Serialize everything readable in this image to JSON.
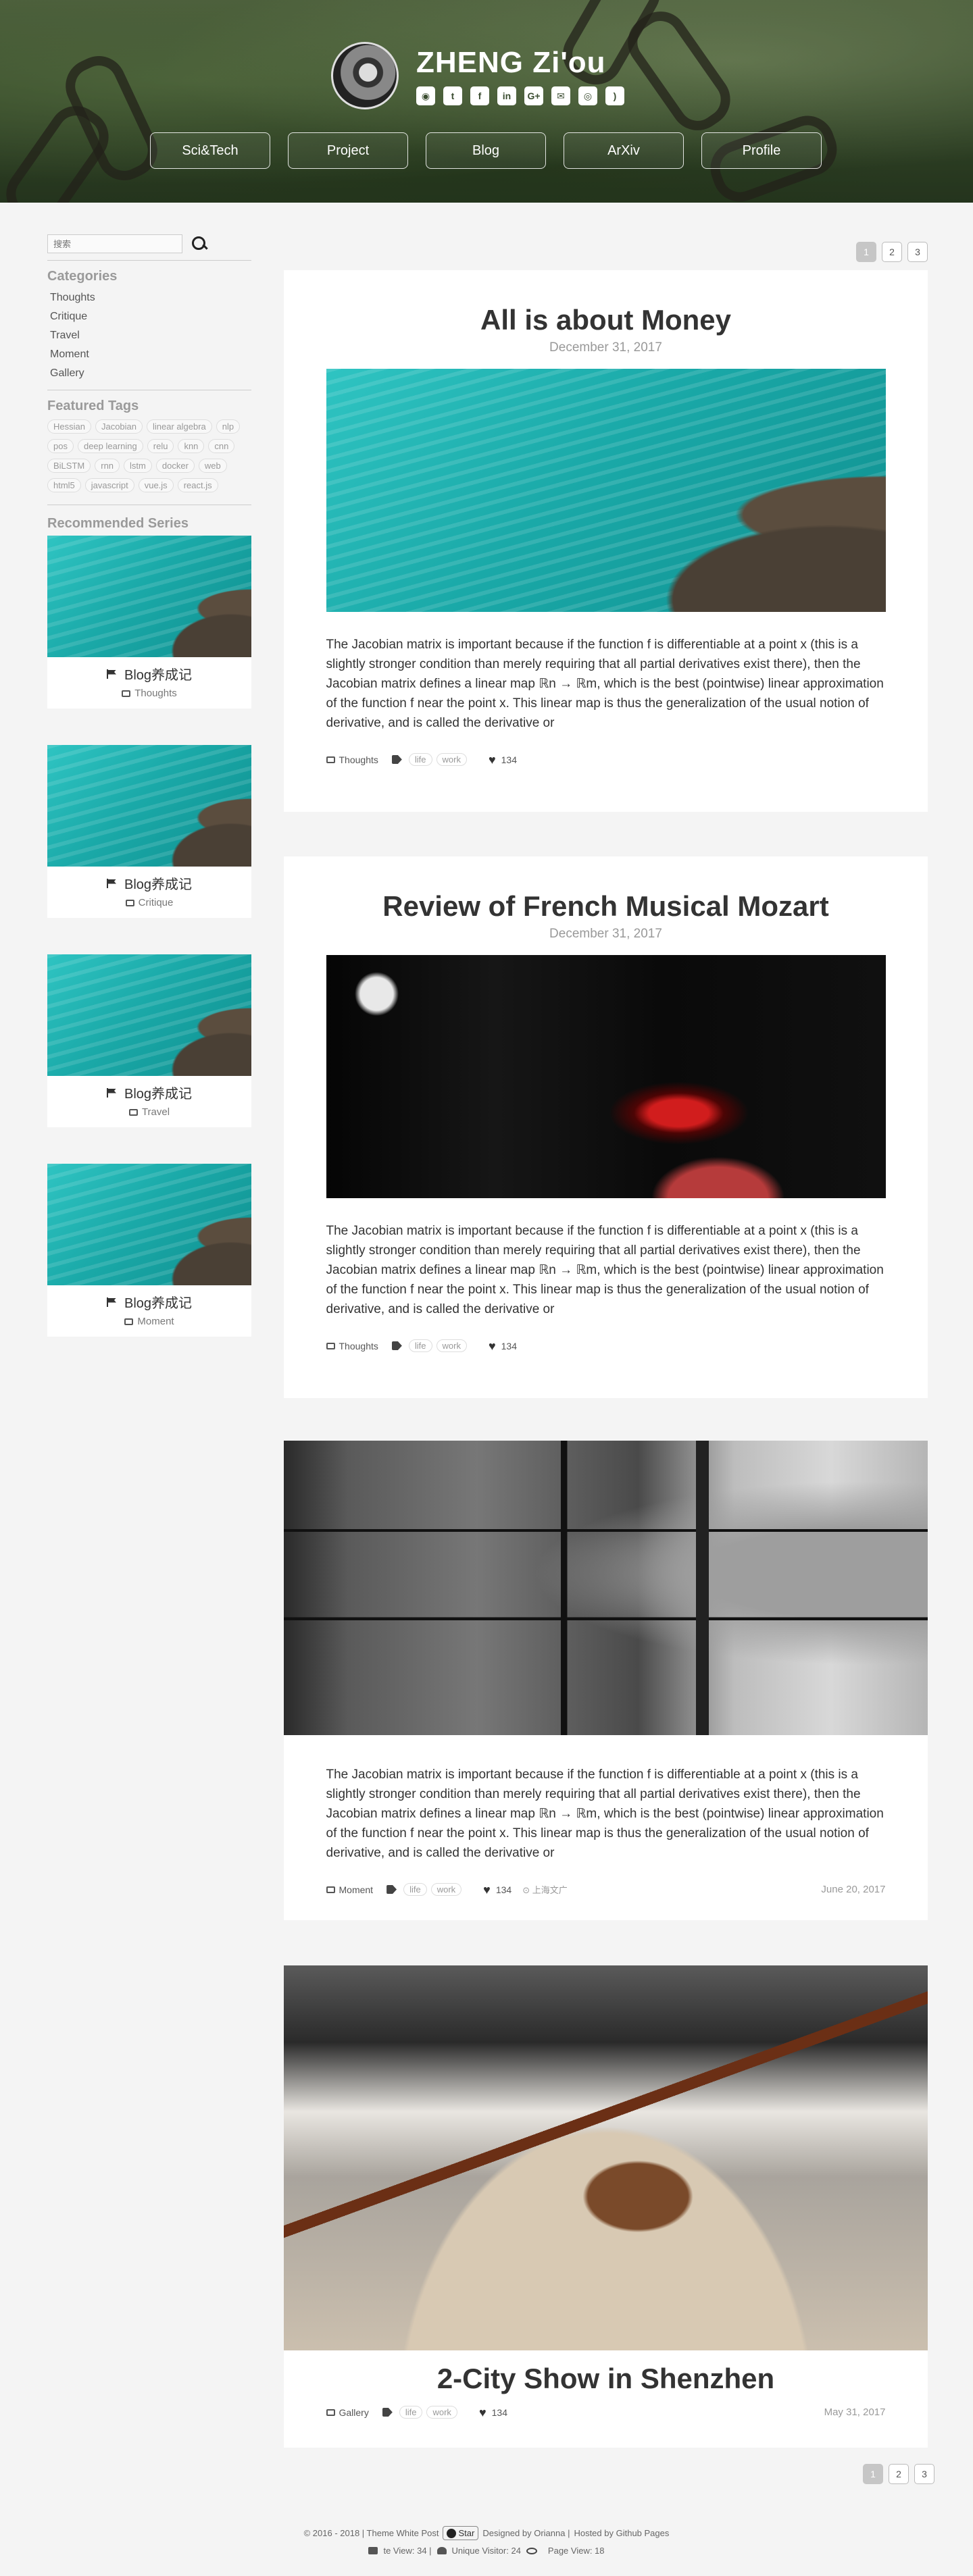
{
  "header": {
    "site_name": "ZHENG Zi'ou",
    "socials": [
      {
        "icon": "github-icon",
        "glyph": "◉"
      },
      {
        "icon": "twitter-icon",
        "glyph": "t"
      },
      {
        "icon": "facebook-icon",
        "glyph": "f"
      },
      {
        "icon": "linkedin-icon",
        "glyph": "in"
      },
      {
        "icon": "google-plus-icon",
        "glyph": "G+"
      },
      {
        "icon": "email-icon",
        "glyph": "✉"
      },
      {
        "icon": "instagram-icon",
        "glyph": "◎"
      },
      {
        "icon": "rss-icon",
        "glyph": ")"
      }
    ],
    "nav": [
      "Sci&Tech",
      "Project",
      "Blog",
      "ArXiv",
      "Profile"
    ]
  },
  "sidebar": {
    "search_placeholder": "搜索",
    "categories_title": "Categories",
    "categories": [
      "Thoughts",
      "Critique",
      "Travel",
      "Moment",
      "Gallery"
    ],
    "tags_title": "Featured Tags",
    "tags": [
      "Hessian",
      "Jacobian",
      "linear algebra",
      "nlp",
      "pos",
      "deep learning",
      "relu",
      "knn",
      "cnn",
      "BiLSTM",
      "rnn",
      "lstm",
      "docker",
      "web",
      "html5",
      "javascript",
      "vue.js",
      "react.js"
    ],
    "series_title": "Recommended Series",
    "series": [
      {
        "title": "Blog养成记",
        "category": "Thoughts"
      },
      {
        "title": "Blog养成记",
        "category": "Critique"
      },
      {
        "title": "Blog养成记",
        "category": "Travel"
      },
      {
        "title": "Blog养成记",
        "category": "Moment"
      }
    ]
  },
  "pagination": [
    "1",
    "2",
    "3"
  ],
  "posts": [
    {
      "title": "All is about Money",
      "date": "December 31, 2017",
      "excerpt": "The Jacobian matrix is important because if the function f is differentiable at a point x (this is a slightly stronger condition than merely requiring that all partial derivatives exist there), then the Jacobian matrix defines a linear map ℝn → ℝm, which is the best (pointwise) linear approximation of the function f near the point x. This linear map is thus the generalization of the usual notion of derivative, and is called the derivative or",
      "category": "Thoughts",
      "tags": [
        "life",
        "work"
      ],
      "likes": "134"
    },
    {
      "title": "Review of French Musical Mozart",
      "date": "December 31, 2017",
      "excerpt": "The Jacobian matrix is important because if the function f is differentiable at a point x (this is a slightly stronger condition than merely requiring that all partial derivatives exist there), then the Jacobian matrix defines a linear map ℝn → ℝm, which is the best (pointwise) linear approximation of the function f near the point x. This linear map is thus the generalization of the usual notion of derivative, and is called the derivative or",
      "category": "Thoughts",
      "tags": [
        "life",
        "work"
      ],
      "likes": "134"
    },
    {
      "excerpt": "The Jacobian matrix is important because if the function f is differentiable at a point x (this is a slightly stronger condition than merely requiring that all partial derivatives exist there), then the Jacobian matrix defines a linear map ℝn → ℝm, which is the best (pointwise) linear approximation of the function f near the point x. This linear map is thus the generalization of the usual notion of derivative, and is called the derivative or",
      "category": "Moment",
      "tags": [
        "life",
        "work"
      ],
      "likes": "134",
      "location": "上海文广",
      "date": "June 20, 2017"
    },
    {
      "title": "2-City Show in Shenzhen",
      "category": "Gallery",
      "tags": [
        "life",
        "work"
      ],
      "likes": "134",
      "date": "May 31, 2017"
    }
  ],
  "footer": {
    "copyright": "© 2016 - 2018 | Theme White Post",
    "star": "Star",
    "designed": "Designed by Orianna |",
    "hosted": "Hosted by Github Pages",
    "site_view": "te View: 34 |",
    "unique_visitor": "Unique Visitor: 24",
    "page_view": "Page View: 18"
  }
}
